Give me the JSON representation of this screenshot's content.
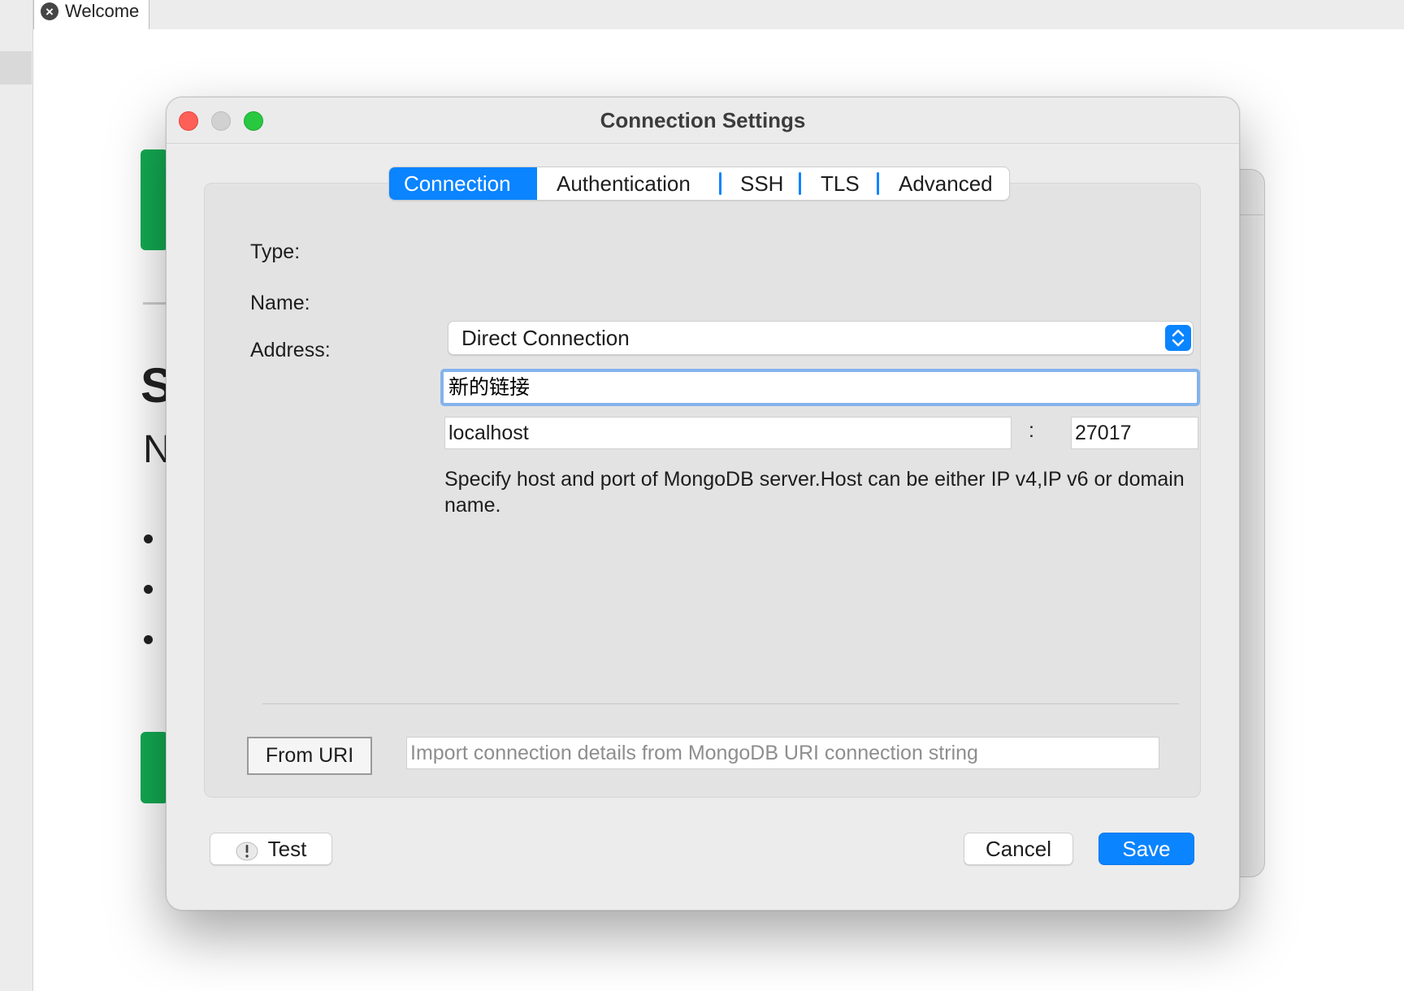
{
  "app": {
    "tab_label": "Welcome",
    "background_text_s": "S",
    "background_text_n": "N"
  },
  "dialog": {
    "title": "Connection Settings",
    "tabs": [
      {
        "label": "Connection",
        "active": true
      },
      {
        "label": "Authentication",
        "active": false
      },
      {
        "label": "SSH",
        "active": false
      },
      {
        "label": "TLS",
        "active": false
      },
      {
        "label": "Advanced",
        "active": false
      }
    ],
    "type_label": "Type:",
    "type_value": "Direct Connection",
    "name_label": "Name:",
    "name_value": "新的链接",
    "address_label": "Address:",
    "address_host": "localhost",
    "address_separator": ":",
    "address_port": "27017",
    "address_hint": "Specify host and port of MongoDB server.Host can be either IP v4,IP v6 or domain name.",
    "from_uri_label": "From URI",
    "uri_placeholder": "Import connection details from MongoDB URI connection string",
    "test_label": "Test",
    "cancel_label": "Cancel",
    "save_label": "Save"
  },
  "colors": {
    "accent": "#0a84ff",
    "focus_ring": "#85b3ec",
    "brand_green": "#13aa52",
    "close_red": "#fe5f57",
    "zoom_green": "#28c840"
  },
  "icons": [
    "close-tab-icon",
    "updown-chevron-icon",
    "warning-icon"
  ]
}
